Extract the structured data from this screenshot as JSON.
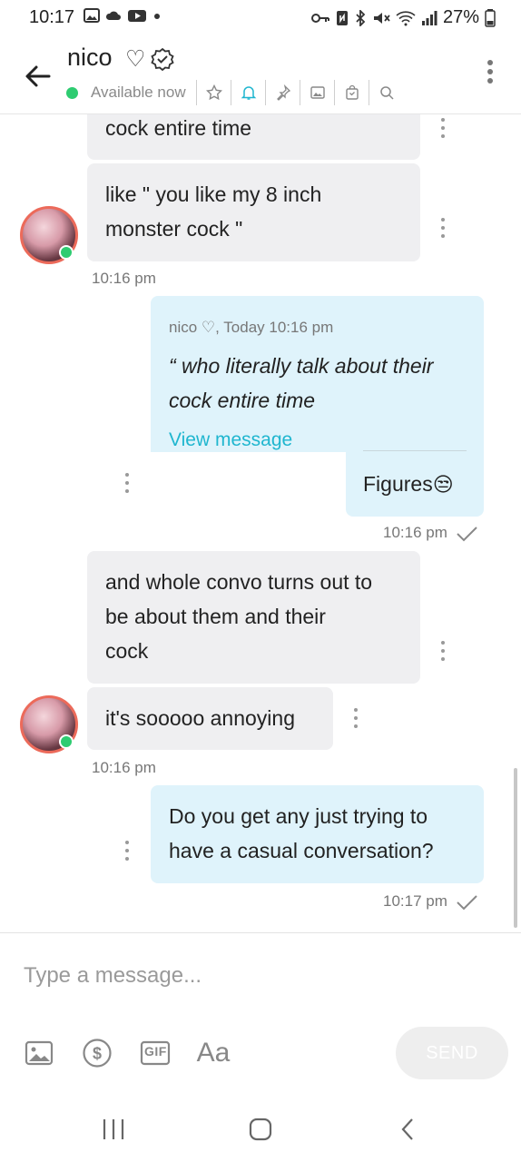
{
  "status_bar": {
    "time": "10:17",
    "battery": "27%",
    "left_icons": [
      "image-icon",
      "cloud-icon",
      "youtube-icon",
      "dot-icon"
    ],
    "right_icons": [
      "key-icon",
      "nfc-icon",
      "bluetooth-icon",
      "mute-icon",
      "wifi-icon",
      "signal-icon",
      "battery-icon"
    ]
  },
  "header": {
    "name": "nico",
    "name_glyph": "♡",
    "availability": "Available now",
    "actions": [
      "star-icon",
      "bell-icon",
      "pin-icon",
      "image-icon",
      "bag-icon",
      "search-icon"
    ],
    "accent_color": "#1fb6cf"
  },
  "messages": {
    "m1": {
      "text": "cock entire time"
    },
    "m2": {
      "lines": [
        "like \" you like my 8 inch",
        "monster cock \""
      ]
    },
    "m2_time": "10:16 pm",
    "reply": {
      "meta": "nico ♡, Today 10:16 pm",
      "quote_lines": [
        "“ who literally talk about their",
        "cock entire time"
      ],
      "view_link": "View message",
      "text": "Figures",
      "emoji": "😒",
      "time": "10:16 pm"
    },
    "m4": {
      "lines": [
        "and whole convo turns out to",
        "be about them and their",
        "cock"
      ]
    },
    "m5": {
      "text": "it's sooooo annoying"
    },
    "m5_time": "10:16 pm",
    "m6": {
      "lines": [
        "Do you get any just trying to",
        "have a casual conversation?"
      ],
      "time": "10:17 pm"
    }
  },
  "composer": {
    "placeholder": "Type a message...",
    "tools": [
      "image-icon",
      "dollar-icon",
      "gif-icon",
      "text-format-icon"
    ],
    "format_label": "Aa",
    "gif_label": "GIF",
    "send_label": "SEND"
  },
  "nav": [
    "recents-icon",
    "home-icon",
    "back-icon"
  ]
}
